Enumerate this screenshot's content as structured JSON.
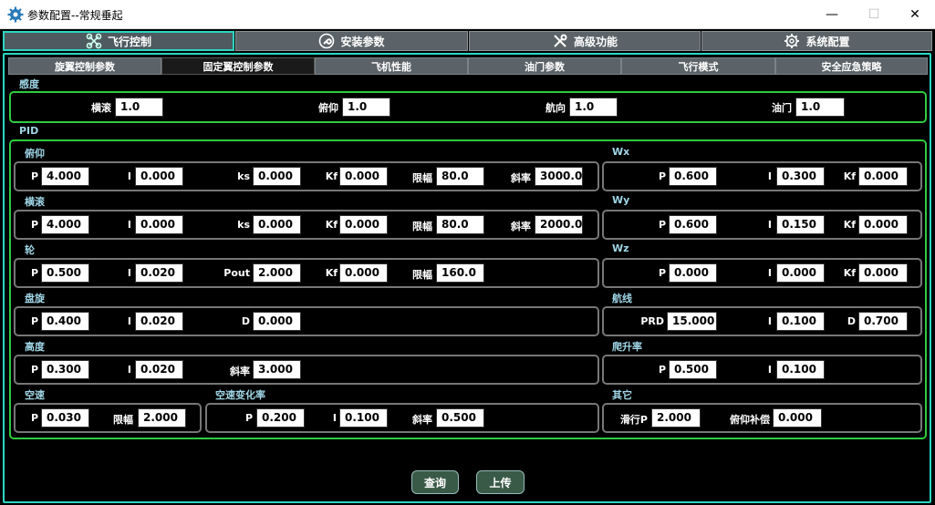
{
  "window": {
    "title": "参数配置--常规垂起",
    "minimize": "—",
    "maximize": "☐",
    "close": "✕"
  },
  "main_tabs": [
    {
      "label": "飞行控制",
      "icon": "drone-icon"
    },
    {
      "label": "安装参数",
      "icon": "wrench-icon"
    },
    {
      "label": "高级功能",
      "icon": "tools-icon"
    },
    {
      "label": "系统配置",
      "icon": "gear-icon"
    }
  ],
  "sub_tabs": [
    "旋翼控制参数",
    "固定翼控制参数",
    "飞机性能",
    "油门参数",
    "飞行模式",
    "安全应急策略"
  ],
  "sensitivity": {
    "label": "感度",
    "fields": [
      {
        "label": "横滚",
        "value": "1.0"
      },
      {
        "label": "俯仰",
        "value": "1.0"
      },
      {
        "label": "航向",
        "value": "1.0"
      },
      {
        "label": "油门",
        "value": "1.0"
      }
    ]
  },
  "pid": {
    "label": "PID",
    "pitch": {
      "label": "俯仰",
      "P": "4.000",
      "I": "0.000",
      "ks": "0.000",
      "Kf": "0.000",
      "limit": "80.0",
      "slope": "3000.0"
    },
    "roll": {
      "label": "横滚",
      "P": "4.000",
      "I": "0.000",
      "ks": "0.000",
      "Kf": "0.000",
      "limit": "80.0",
      "slope": "2000.0"
    },
    "wheel": {
      "label": "轮",
      "P": "0.500",
      "I": "0.020",
      "Pout": "2.000",
      "Kf": "0.000",
      "limit": "160.0"
    },
    "circle": {
      "label": "盘旋",
      "P": "0.400",
      "I": "0.020",
      "D": "0.000"
    },
    "altitude": {
      "label": "高度",
      "P": "0.300",
      "I": "0.020",
      "slope": "3.000"
    },
    "airspeed": {
      "label": "空速",
      "P": "0.030",
      "limit": "2.000"
    },
    "airspeed_rate": {
      "label": "空速变化率",
      "P": "0.200",
      "I": "0.100",
      "slope": "0.500"
    },
    "wx": {
      "label": "Wx",
      "P": "0.600",
      "I": "0.300",
      "Kf": "0.000"
    },
    "wy": {
      "label": "Wy",
      "P": "0.600",
      "I": "0.150",
      "Kf": "0.000"
    },
    "wz": {
      "label": "Wz",
      "P": "0.000",
      "I": "0.000",
      "Kf": "0.000"
    },
    "route": {
      "label": "航线",
      "PRD": "15.000",
      "I": "0.100",
      "D": "0.700"
    },
    "climb": {
      "label": "爬升率",
      "P": "0.500",
      "I": "0.100"
    },
    "other": {
      "label": "其它",
      "taxi_p": "2.000",
      "pitch_comp": "0.000"
    }
  },
  "field_labels": {
    "P": "P",
    "I": "I",
    "D": "D",
    "ks": "ks",
    "Kf": "Kf",
    "Pout": "Pout",
    "PRD": "PRD",
    "limit": "限幅",
    "slope": "斜率",
    "taxi_p": "滑行P",
    "pitch_comp": "俯仰补偿"
  },
  "buttons": {
    "query": "查询",
    "upload": "上传"
  },
  "colors": {
    "accent": "#2bd6c2",
    "group_border": "#2ecc40",
    "tab_bg": "#5b6368",
    "label": "#9fd6e6"
  }
}
